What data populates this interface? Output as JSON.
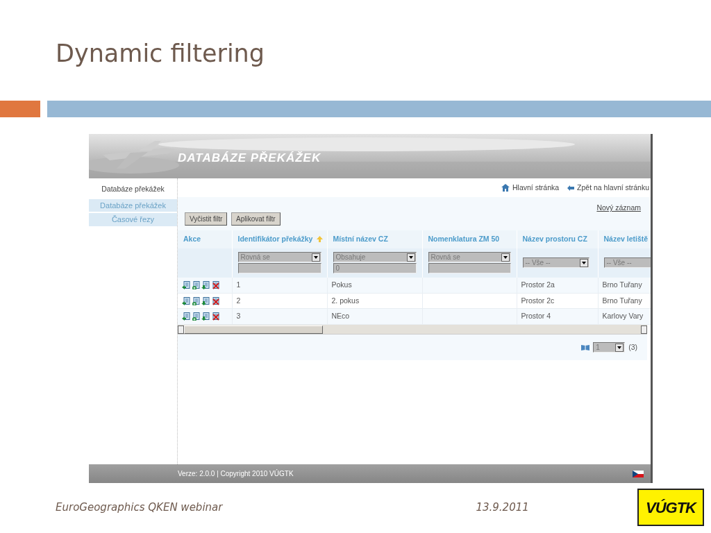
{
  "slide": {
    "title": "Dynamic filtering",
    "footer_left": "EuroGeographics QKEN webinar",
    "footer_date": "13.9.2011",
    "logo_text": "VÚGTK"
  },
  "app": {
    "banner_title": "DATABÁZE PŘEKÁŽEK",
    "sidebar": {
      "heading": "Databáze překážek",
      "items": [
        {
          "label": "Databáze překážek"
        },
        {
          "label": "Časové řezy"
        }
      ]
    },
    "top_links": [
      {
        "kind": "home",
        "label": "Hlavní stránka"
      },
      {
        "kind": "back",
        "label": "Zpět na hlavní stránku"
      }
    ],
    "new_record_link": "Nový záznam",
    "buttons": [
      "Vyčistit filtr",
      "Aplikovat filtr"
    ],
    "table": {
      "columns": [
        {
          "label": "Akce",
          "sorted": false,
          "filter": {
            "kind": "none"
          }
        },
        {
          "label": "Identifikátor překážky",
          "sorted": true,
          "filter": {
            "kind": "select_text",
            "operator": "Rovná se"
          }
        },
        {
          "label": "Místní název CZ",
          "sorted": false,
          "filter": {
            "kind": "select_text",
            "operator": "Obsahuje",
            "value": "0"
          }
        },
        {
          "label": "Nomenklatura ZM 50",
          "sorted": false,
          "filter": {
            "kind": "select_text",
            "operator": "Rovná se"
          }
        },
        {
          "label": "Název prostoru CZ",
          "sorted": false,
          "filter": {
            "kind": "select",
            "operator": "-- Vše --"
          }
        },
        {
          "label": "Název letiště",
          "sorted": false,
          "filter": {
            "kind": "select",
            "operator": "-- Vše --"
          }
        }
      ],
      "rows": [
        {
          "cells": [
            "",
            "1",
            "Pokus",
            "",
            "Prostor 2a",
            "Brno Tuřany"
          ]
        },
        {
          "cells": [
            "",
            "2",
            "2. pokus",
            "",
            "Prostor 2c",
            "Brno Tuřany"
          ]
        },
        {
          "cells": [
            "",
            "3",
            "NEco",
            "",
            "Prostor 4",
            "Karlovy Vary"
          ]
        }
      ]
    },
    "pager": {
      "page": "1",
      "count": "(3)"
    },
    "footer": "Verze: 2.0.0 | Copyright 2010 VÚGTK"
  }
}
